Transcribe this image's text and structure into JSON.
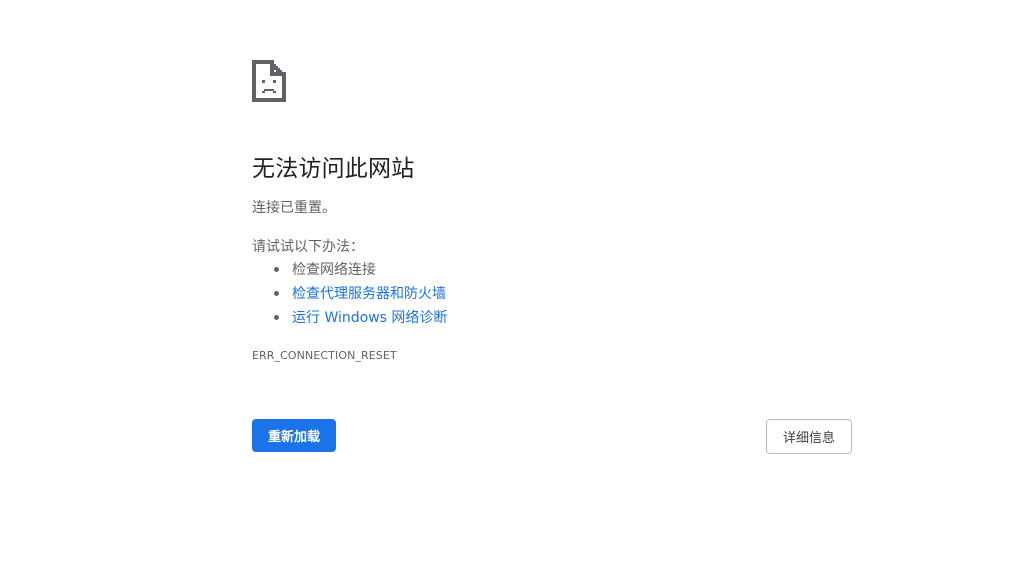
{
  "error": {
    "icon": "sad-page-icon",
    "title": "无法访问此网站",
    "subtitle": "连接已重置。",
    "suggestions_heading": "请试试以下办法：",
    "suggestions": [
      {
        "label": "检查网络连接",
        "is_link": false
      },
      {
        "label": "检查代理服务器和防火墙",
        "is_link": true
      },
      {
        "label": "运行 Windows 网络诊断",
        "is_link": true
      }
    ],
    "code": "ERR_CONNECTION_RESET"
  },
  "buttons": {
    "reload_label": "重新加载",
    "details_label": "详细信息"
  },
  "colors": {
    "accent": "#1a73e8",
    "text": "#202124",
    "secondary_text": "#5f6368",
    "background": "#ffffff"
  }
}
